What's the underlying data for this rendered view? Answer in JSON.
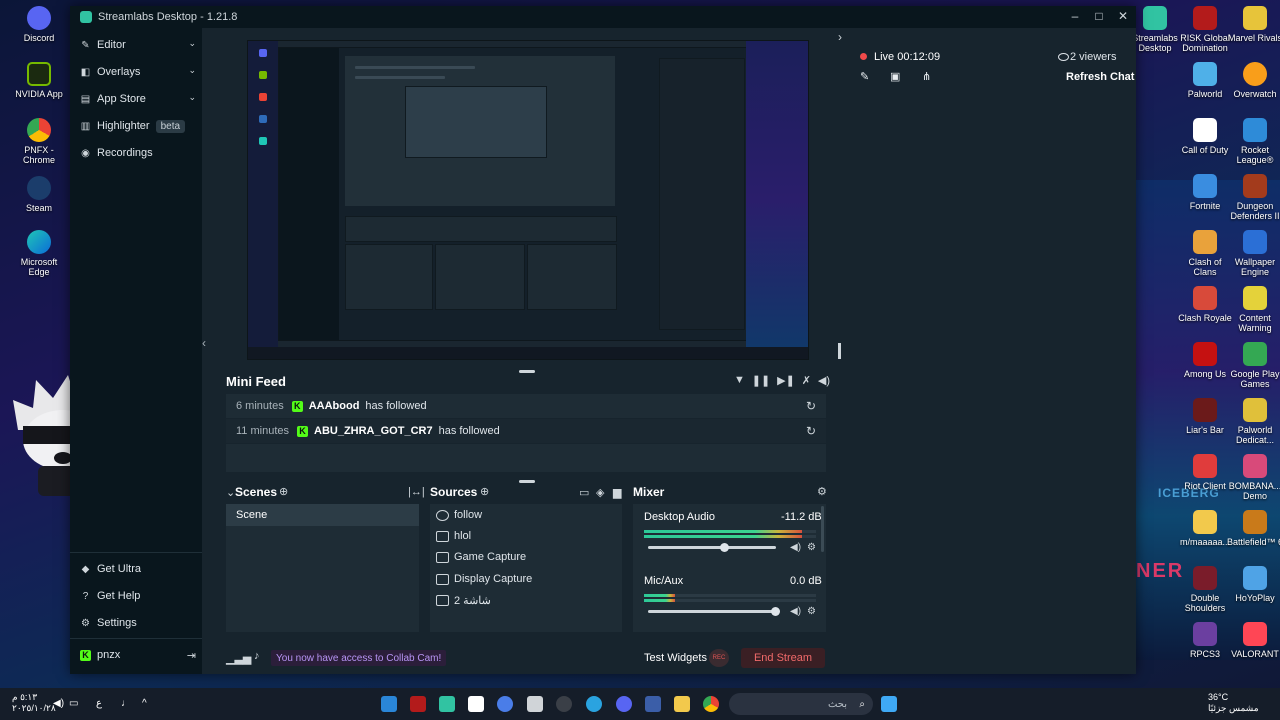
{
  "window": {
    "title": "Streamlabs Desktop - 1.21.8",
    "controls": [
      "minimize",
      "maximize",
      "close"
    ]
  },
  "sidebar": {
    "items": [
      {
        "label": "Editor",
        "icon": "pen-icon"
      },
      {
        "label": "Overlays",
        "icon": "overlays-icon"
      },
      {
        "label": "App Store",
        "icon": "store-icon"
      },
      {
        "label": "Highlighter",
        "icon": "highlighter-icon",
        "badge": "beta"
      },
      {
        "label": "Recordings",
        "icon": "recordings-icon"
      }
    ],
    "bottom": [
      {
        "label": "Get Ultra",
        "icon": "ultra-icon"
      },
      {
        "label": "Get Help",
        "icon": "help-icon"
      },
      {
        "label": "Settings",
        "icon": "gear-icon"
      }
    ],
    "user": "pnzx"
  },
  "chat": {
    "live_label": "Live",
    "live_time": "00:12:09",
    "viewers": "2 viewers",
    "refresh_label": "Refresh Chat"
  },
  "mini_feed": {
    "title": "Mini Feed",
    "rows": [
      {
        "time": "6 minutes",
        "user": "AAAbood",
        "action": "has followed"
      },
      {
        "time": "11 minutes",
        "user": "ABU_ZHRA_GOT_CR7",
        "action": "has followed"
      }
    ]
  },
  "scenes": {
    "title": "Scenes",
    "items": [
      "Scene"
    ]
  },
  "sources": {
    "title": "Sources",
    "items": [
      {
        "label": "follow",
        "icon": "globe-icon"
      },
      {
        "label": "hlol",
        "icon": "gamepad-icon"
      },
      {
        "label": "Game Capture",
        "icon": "gamepad-icon"
      },
      {
        "label": "Display Capture",
        "icon": "monitor-icon"
      },
      {
        "label": "شاشة 2",
        "icon": "monitor-icon"
      }
    ]
  },
  "mixer": {
    "title": "Mixer",
    "channels": [
      {
        "name": "Desktop Audio",
        "db": "-11.2 dB",
        "level": 0.92,
        "volume": 0.6
      },
      {
        "name": "Mic/Aux",
        "db": "0.0 dB",
        "level": 0.18,
        "volume": 1.0
      }
    ]
  },
  "footer": {
    "collab_notice": "You now have access to Collab Cam!",
    "test_widgets": "Test Widgets",
    "rec_label": "REC",
    "end_stream": "End Stream"
  },
  "desktop_left": [
    "Discord",
    "NVIDIA App",
    "PNFX - Chrome",
    "Steam",
    "Microsoft Edge"
  ],
  "desktop_right": [
    [
      "Streamlabs Desktop",
      "RISK Global Domination",
      "Marvel Rivals"
    ],
    [
      "Palworld",
      "Overwatch"
    ],
    [
      "Call of Duty",
      "Rocket League®"
    ],
    [
      "Fortnite",
      "Dungeon Defenders II"
    ],
    [
      "Clash of Clans",
      "Wallpaper Engine"
    ],
    [
      "Clash Royale",
      "Content Warning"
    ],
    [
      "Among Us",
      "Google Play Games"
    ],
    [
      "Liar's Bar",
      "Palworld Dedicat..."
    ],
    [
      "Riot Client",
      "BOMBANA... Demo"
    ],
    [
      "m/maaaaa...",
      "Battlefield™ 6"
    ],
    [
      "Double Shoulders",
      "HoYoPlay"
    ],
    [
      "RPCS3",
      "VALORANT"
    ]
  ],
  "taskbar": {
    "search_placeholder": "بحث",
    "clock_time": "٥:١٣ م",
    "clock_date": "٢٠٢٥/١٠/٢٨",
    "lang": "ع",
    "weather_temp": "36°C",
    "weather_desc": "مشمس جزئيًا"
  },
  "colors": {
    "accent": "#31c3a2",
    "kick_green": "#53fc18",
    "live_red": "#f04a4a",
    "end_stream": "#f06a6a",
    "collab_text": "#b794f4"
  }
}
